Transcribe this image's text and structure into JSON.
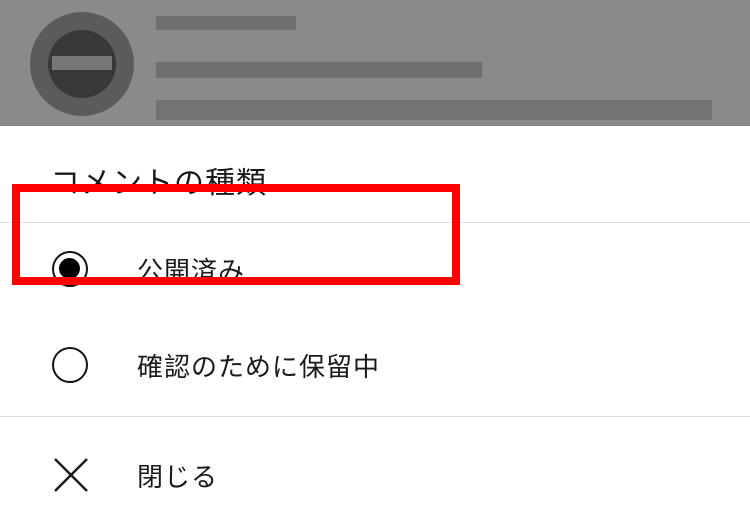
{
  "sheet": {
    "title": "コメントの種類",
    "options": [
      {
        "label": "公開済み",
        "selected": true
      },
      {
        "label": "確認のために保留中",
        "selected": false
      }
    ],
    "close_label": "閉じる"
  },
  "highlight_color": "#ff0000"
}
